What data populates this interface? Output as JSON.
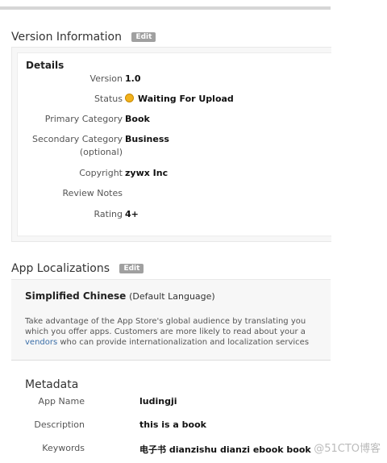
{
  "version_info": {
    "title": "Version Information",
    "edit_label": "Edit",
    "details_title": "Details",
    "rows": [
      {
        "label": "Version",
        "value": "1.0"
      },
      {
        "label": "Status",
        "value": "Waiting For Upload",
        "icon": "status-dot-icon"
      },
      {
        "label": "Primary Category",
        "value": "Book"
      },
      {
        "label": "Secondary Category",
        "label2": "(optional)",
        "value": "Business"
      },
      {
        "label": "Copyright",
        "value": "zywx Inc"
      },
      {
        "label": "Review Notes",
        "value": ""
      },
      {
        "label": "Rating",
        "value": "4+"
      }
    ]
  },
  "localizations": {
    "title": "App Localizations",
    "edit_label": "Edit",
    "language": "Simplified Chinese",
    "language_note": "(Default Language)",
    "desc_line1": "Take advantage of the App Store's global audience by translating you",
    "desc_line2": "which you offer apps. Customers are more likely to read about your a",
    "desc_line3_link": "vendors",
    "desc_line3_rest": " who can provide internationalization and localization services"
  },
  "metadata": {
    "title": "Metadata",
    "rows": [
      {
        "label": "App Name",
        "value": "ludingji"
      },
      {
        "label": "Description",
        "value": "this is a book"
      },
      {
        "label": "Keywords",
        "value": "电子书 dianzishu dianzi ebook book"
      }
    ]
  },
  "watermark": "@51CTO博客",
  "colors": {
    "status": "#f2b21d",
    "link": "#3a6ea8",
    "edit_bg": "#a0a0a0"
  }
}
